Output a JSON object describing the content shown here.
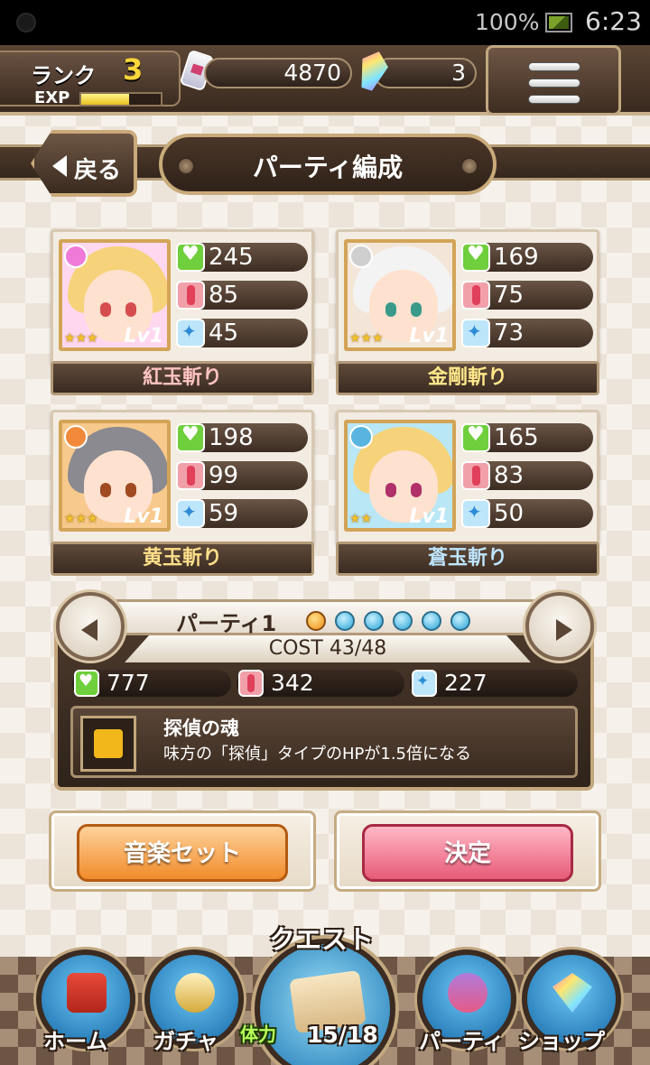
{
  "status_bar": {
    "battery": "100%",
    "time": "6:23"
  },
  "header": {
    "rank_label": "ランク",
    "rank_value": "3",
    "exp_label": "EXP",
    "exp_progress_percent": 60,
    "item_count": "4870",
    "gem_count": "3"
  },
  "title_bar": {
    "back_label": "戻る",
    "title": "パーティ編成"
  },
  "cards": [
    {
      "name": "紅玉斬り",
      "hp": "245",
      "atk": "85",
      "def": "45",
      "level": "Lv1",
      "stars": "★★★",
      "name_color": "#ffc3c3",
      "attr_color": "#f07ad8",
      "hair_color": "#f6d37a",
      "bg_color": "#ffd8ef",
      "eye_color": "#d64d4d"
    },
    {
      "name": "金剛斬り",
      "hp": "169",
      "atk": "75",
      "def": "73",
      "level": "Lv1",
      "stars": "★★★",
      "name_color": "#ffe88a",
      "attr_color": "#cfcfcf",
      "hair_color": "#f3f3f3",
      "bg_color": "#f3e6d8",
      "eye_color": "#3a9a8a"
    },
    {
      "name": "黄玉斬り",
      "hp": "198",
      "atk": "99",
      "def": "59",
      "level": "Lv1",
      "stars": "★★★",
      "name_color": "#ffdf8a",
      "attr_color": "#f08a3a",
      "hair_color": "#8a8a90",
      "bg_color": "#f7c98c",
      "eye_color": "#a04a22"
    },
    {
      "name": "蒼玉斬り",
      "hp": "165",
      "atk": "83",
      "def": "50",
      "level": "Lv1",
      "stars": "★★",
      "name_color": "#bfe6ff",
      "attr_color": "#58b5e0",
      "hair_color": "#f6d37a",
      "bg_color": "#b9e7f6",
      "eye_color": "#b0306a"
    }
  ],
  "party": {
    "name": "パーティ1",
    "active_index": 0,
    "slots": 6,
    "cost": "COST 43/48",
    "total_hp": "777",
    "total_atk": "342",
    "total_def": "227",
    "skill_name": "探偵の魂",
    "skill_desc": "味方の「探偵」タイプのHPが1.5倍になる"
  },
  "buttons": {
    "music_set": "音楽セット",
    "confirm": "決定"
  },
  "nav": {
    "home": "ホーム",
    "gacha": "ガチャ",
    "quest": "クエスト",
    "stamina_label": "体力",
    "stamina_value": "15/18",
    "party": "パーティ",
    "shop": "ショップ"
  }
}
